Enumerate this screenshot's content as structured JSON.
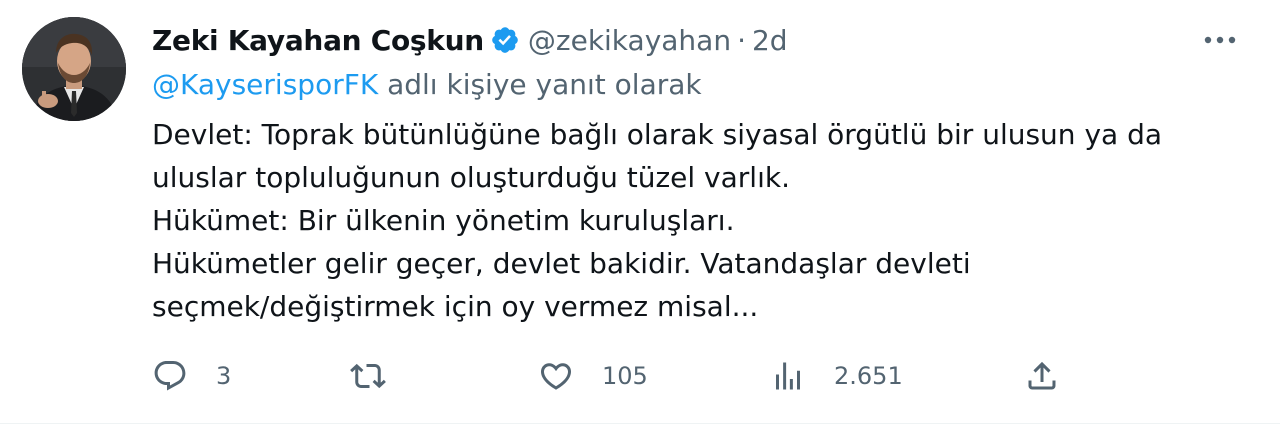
{
  "tweet": {
    "author": {
      "display_name": "Zeki Kayahan Coşkun",
      "handle": "@zekikayahan",
      "verified": true
    },
    "separator": "·",
    "time": "2d",
    "reply_to": {
      "mention": "@KayserisporFK",
      "suffix": " adlı kişiye yanıt olarak"
    },
    "text_lines": [
      "Devlet: Toprak bütünlüğüne bağlı olarak siyasal örgütlü bir ulusun ya da",
      "uluslar topluluğunun oluşturduğu tüzel varlık.",
      "Hükümet: Bir ülkenin yönetim kuruluşları.",
      "Hükümetler gelir geçer, devlet bakidir. Vatandaşlar devleti",
      "seçmek/değiştirmek için oy vermez misal..."
    ],
    "actions": {
      "reply": {
        "icon": "reply-icon",
        "count": "3"
      },
      "retweet": {
        "icon": "retweet-icon",
        "count": ""
      },
      "like": {
        "icon": "heart-icon",
        "count": "105"
      },
      "views": {
        "icon": "views-icon",
        "count": "2.651"
      },
      "share": {
        "icon": "share-icon"
      }
    }
  },
  "colors": {
    "text_primary": "#0f1419",
    "text_secondary": "#536471",
    "accent": "#1d9bf0"
  }
}
